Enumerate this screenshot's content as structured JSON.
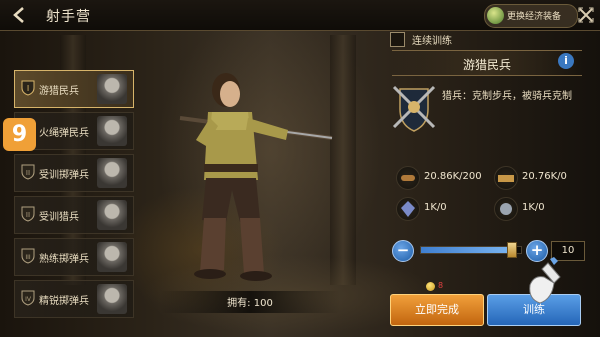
{
  "header": {
    "title": "射手营",
    "eco_button_label": "更换经济装备"
  },
  "step_badge": "9",
  "unit_list": [
    {
      "label": "游猎民兵",
      "selected": true
    },
    {
      "label": "火绳弹民兵",
      "selected": false
    },
    {
      "label": "受训掷弹兵",
      "selected": false
    },
    {
      "label": "受训猎兵",
      "selected": false
    },
    {
      "label": "熟练掷弹兵",
      "selected": false
    },
    {
      "label": "精锐掷弹兵",
      "selected": false
    }
  ],
  "owned_text": "拥有: 100",
  "panel": {
    "continuous_training_label": "连续训练",
    "continuous_training_checked": false,
    "unit_name": "游猎民兵",
    "description": "猎兵：克制步兵，被骑兵克制",
    "resources": [
      {
        "icon": "wood-icon",
        "value": "20.86K/200"
      },
      {
        "icon": "iron-icon",
        "value": "20.76K/0"
      },
      {
        "icon": "gem-icon",
        "value": "1K/0"
      },
      {
        "icon": "stone-icon",
        "value": "1K/0"
      }
    ],
    "slider_fraction": 0.9,
    "quantity": "10",
    "instant_cost": "8",
    "finish_now_label": "立即完成",
    "train_label": "训练"
  },
  "colors": {
    "finish_button": "#e8892a",
    "train_button": "#3f82d2",
    "badge": "#f0a037",
    "accent_gold": "#d7b46a"
  }
}
